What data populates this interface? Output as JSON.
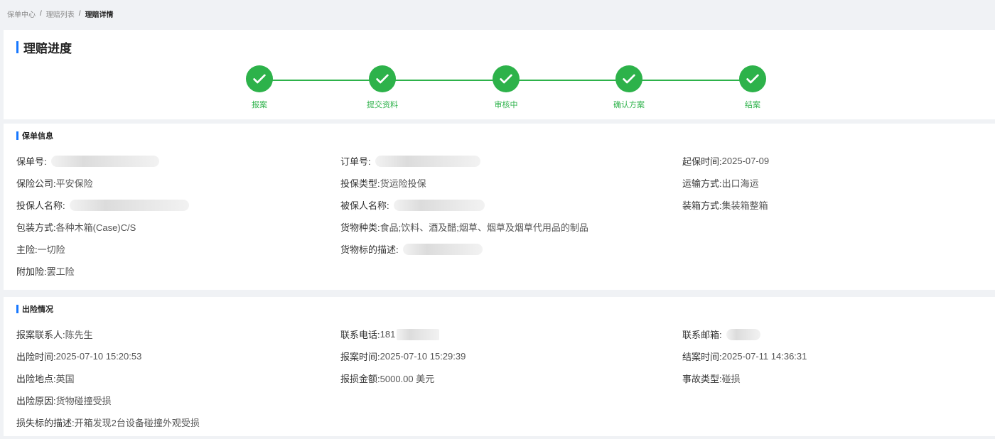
{
  "breadcrumb": {
    "items": [
      "保单中心",
      "理赔列表"
    ],
    "current": "理赔详情",
    "separator": "/"
  },
  "progress": {
    "title": "理赔进度",
    "steps": [
      {
        "label": "报案",
        "status": "done"
      },
      {
        "label": "提交资料",
        "status": "done"
      },
      {
        "label": "审核中",
        "status": "done"
      },
      {
        "label": "确认方案",
        "status": "done"
      },
      {
        "label": "结案",
        "status": "done"
      }
    ],
    "color": "#2db24a"
  },
  "policy": {
    "title": "保单信息",
    "policy_no": {
      "label": "保单号:",
      "value": ""
    },
    "order_no": {
      "label": "订单号:",
      "value": ""
    },
    "start_date": {
      "label": "起保时间:",
      "value": "2025-07-09"
    },
    "insurer": {
      "label": "保险公司:",
      "value": "平安保险"
    },
    "insure_type": {
      "label": "投保类型:",
      "value": "货运险投保"
    },
    "transport": {
      "label": "运输方式:",
      "value": "出口海运"
    },
    "policyholder": {
      "label": "投保人名称:",
      "value": ""
    },
    "insured": {
      "label": "被保人名称:",
      "value": ""
    },
    "packing_mode": {
      "label": "装箱方式:",
      "value": "集装箱整箱"
    },
    "package": {
      "label": "包装方式:",
      "value": "各种木箱(Case)C/S"
    },
    "goods_type": {
      "label": "货物种类:",
      "value": "食品;饮料、酒及醋;烟草、烟草及烟草代用品的制品"
    },
    "main_risk": {
      "label": "主险:",
      "value": "一切险"
    },
    "goods_desc": {
      "label": "货物标的描述:",
      "value": ""
    },
    "additional": {
      "label": "附加险:",
      "value": "罢工险"
    }
  },
  "accident": {
    "title": "出险情况",
    "contact": {
      "label": "报案联系人:",
      "value": "陈先生"
    },
    "phone": {
      "label": "联系电话:",
      "value": "181"
    },
    "email": {
      "label": "联系邮箱:",
      "value": ""
    },
    "accident_time": {
      "label": "出险时间:",
      "value": "2025-07-10 15:20:53"
    },
    "report_time": {
      "label": "报案时间:",
      "value": "2025-07-10 15:29:39"
    },
    "close_time": {
      "label": "结案时间:",
      "value": "2025-07-11 14:36:31"
    },
    "location": {
      "label": "出险地点:",
      "value": "英国"
    },
    "loss_amount": {
      "label": "报损金额:",
      "value": "5000.00 美元"
    },
    "accident_type": {
      "label": "事故类型:",
      "value": "碰损"
    },
    "cause": {
      "label": "出险原因:",
      "value": "货物碰撞受损"
    },
    "loss_desc": {
      "label": "损失标的描述:",
      "value": "开箱发现2台设备碰撞外观受损"
    }
  },
  "accent_color": "#1677ff"
}
